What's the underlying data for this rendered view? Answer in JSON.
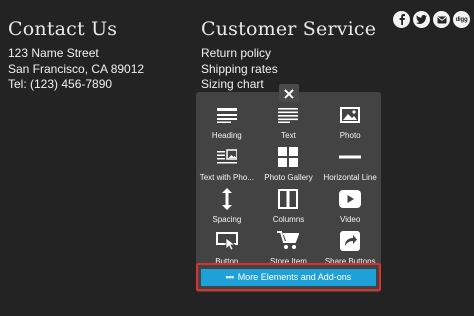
{
  "contact": {
    "title": "Contact Us",
    "lines": [
      "123 Name Street",
      "San Francisco, CA 89012",
      "Tel: (123) 456-7890"
    ]
  },
  "service": {
    "title": "Customer Service",
    "links": [
      "Return policy",
      "Shipping rates",
      "Sizing chart"
    ]
  },
  "social": {
    "icons": [
      "facebook-icon",
      "twitter-icon",
      "email-icon",
      "digg-icon"
    ],
    "digg_text": "digg"
  },
  "panel": {
    "close_glyph": "×",
    "elements": [
      {
        "label": "Heading",
        "icon": "heading-icon"
      },
      {
        "label": "Text",
        "icon": "text-icon"
      },
      {
        "label": "Photo",
        "icon": "photo-icon"
      },
      {
        "label": "Text with Pho...",
        "icon": "text-with-photo-icon"
      },
      {
        "label": "Photo Gallery",
        "icon": "photo-gallery-icon"
      },
      {
        "label": "Horizontal Line",
        "icon": "horizontal-line-icon"
      },
      {
        "label": "Spacing",
        "icon": "spacing-icon"
      },
      {
        "label": "Columns",
        "icon": "columns-icon"
      },
      {
        "label": "Video",
        "icon": "video-icon"
      },
      {
        "label": "Button",
        "icon": "button-icon"
      },
      {
        "label": "Store Item",
        "icon": "store-item-icon"
      },
      {
        "label": "Share Buttons",
        "icon": "share-buttons-icon"
      }
    ],
    "more_label": "More Elements and Add-ons",
    "more_dots": "•••"
  },
  "colors": {
    "background": "#232323",
    "panel": "#434343",
    "accent_button": "#1ea1d9",
    "highlight_border": "#d9322f"
  }
}
